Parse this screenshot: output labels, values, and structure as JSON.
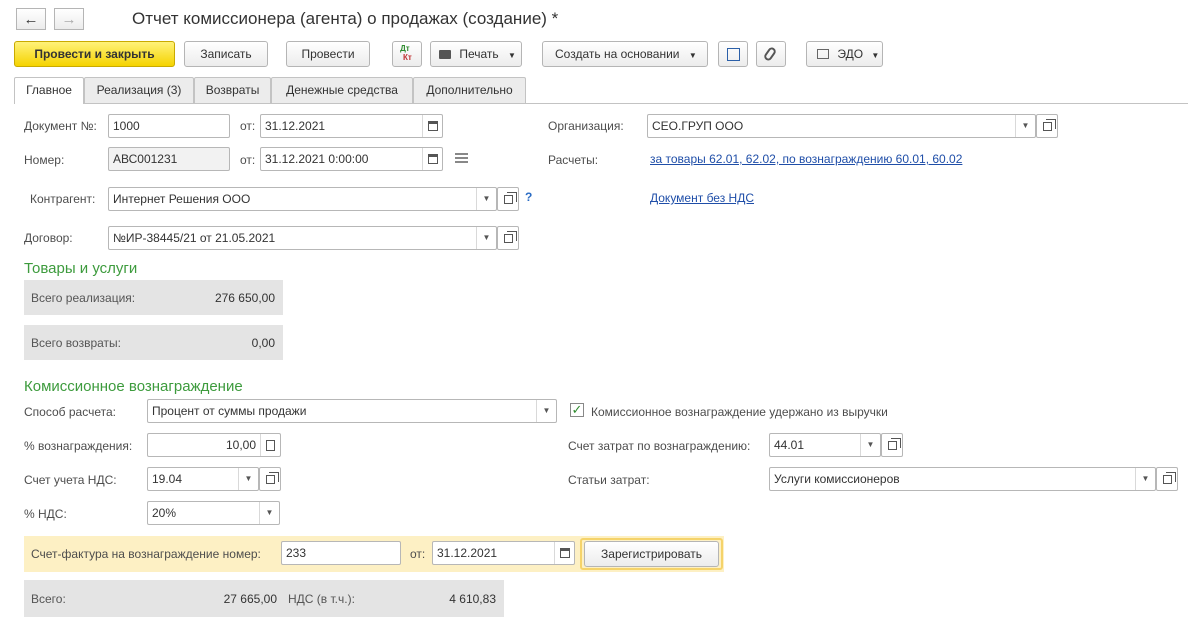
{
  "window": {
    "title": "Отчет комиссионера (агента) о продажах (создание) *"
  },
  "toolbar": {
    "post_close": "Провести и закрыть",
    "save": "Записать",
    "post": "Провести",
    "dtkt_top": "Дт",
    "dtkt_bottom": "Кт",
    "print": "Печать",
    "create_based": "Создать на основании",
    "edo": "ЭДО"
  },
  "tabs": [
    {
      "label": "Главное"
    },
    {
      "label": "Реализация (3)"
    },
    {
      "label": "Возвраты"
    },
    {
      "label": "Денежные средства"
    },
    {
      "label": "Дополнительно"
    }
  ],
  "header": {
    "doc_no_label": "Документ №:",
    "doc_no": "1000",
    "from_label": "от:",
    "doc_date": "31.12.2021",
    "number_label": "Номер:",
    "number": "АВС001231",
    "number_date": "31.12.2021  0:00:00",
    "org_label": "Организация:",
    "org": "СЕО.ГРУП ООО",
    "calc_label": "Расчеты:",
    "calc_link": "за товары 62.01, 62.02, по вознаграждению 60.01, 60.02",
    "contractor_label": "Контрагент:",
    "contractor": "Интернет Решения ООО",
    "help": "?",
    "no_vat_link": "Документ без НДС",
    "contract_label": "Договор:",
    "contract": "№ИР-38445/21 от 21.05.2021"
  },
  "goods": {
    "title": "Товары и услуги",
    "total_sales_label": "Всего реализация:",
    "total_sales": "276 650,00",
    "total_returns_label": "Всего возвраты:",
    "total_returns": "0,00"
  },
  "commission": {
    "title": "Комиссионное вознаграждение",
    "method_label": "Способ расчета:",
    "method": "Процент от суммы продажи",
    "withheld_label": "Комиссионное вознаграждение удержано из выручки",
    "withheld_checked": true,
    "percent_label": "% вознаграждения:",
    "percent": "10,00",
    "cost_account_label": "Счет затрат по вознаграждению:",
    "cost_account": "44.01",
    "vat_account_label": "Счет учета НДС:",
    "vat_account": "19.04",
    "cost_items_label": "Статьи затрат:",
    "cost_items": "Услуги комиссионеров",
    "vat_rate_label": "% НДС:",
    "vat_rate": "20%",
    "invoice_label": "Счет-фактура на вознаграждение номер:",
    "invoice_no": "233",
    "invoice_from_label": "от:",
    "invoice_date": "31.12.2021",
    "register_button": "Зарегистрировать",
    "total_label": "Всего:",
    "total": "27 665,00",
    "vat_incl_label": "НДС (в т.ч.):",
    "vat_incl": "4 610,83"
  }
}
